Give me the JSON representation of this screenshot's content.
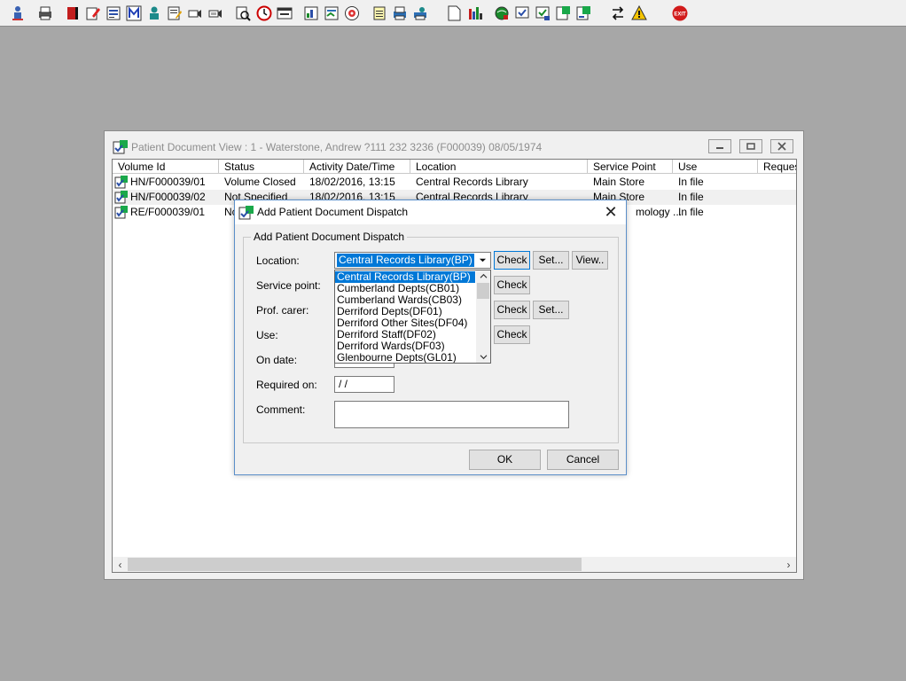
{
  "toolbar": {
    "icons": [
      "user-search-icon",
      "printer-icon",
      "book-red-icon",
      "edit-doc-icon",
      "list-form-icon",
      "mail-m-icon",
      "doctor-icon",
      "note-edit-icon",
      "projector-icon",
      "projector2-icon",
      "doc-search-icon",
      "clock-icon",
      "window-icon",
      "chart-doc-icon",
      "form-doc-icon",
      "cd-icon",
      "notepad-icon",
      "printer2-icon",
      "printer-user-icon",
      "blank-page-icon",
      "bar-chart-icon",
      "globe-tool-icon",
      "check-doc-icon",
      "check-doc2-icon",
      "doc-green-icon",
      "doc-green2-icon",
      "swap-arrows-icon",
      "warning-icon",
      "exit-icon"
    ],
    "exit_label": "EXIT"
  },
  "background_window": {
    "title": "Patient Document View : 1 - Waterstone, Andrew ?111 232 3236 (F000039) 08/05/1974",
    "columns": [
      "Volume Id",
      "Status",
      "Activity Date/Time",
      "Location",
      "Service Point",
      "Use",
      "Reques"
    ],
    "rows": [
      {
        "volume_id": "HN/F000039/01",
        "status": "Volume Closed",
        "activity": "18/02/2016, 13:15",
        "location": "Central Records Library",
        "service_point": "Main Store",
        "use": "In file"
      },
      {
        "volume_id": "HN/F000039/02",
        "status": "Not Specified",
        "activity": "18/02/2016, 13:15",
        "location": "Central Records Library",
        "service_point": "Main Store",
        "use": "In file"
      },
      {
        "volume_id": "RE/F000039/01",
        "status": "Nc",
        "activity": "",
        "location": "",
        "service_point": "mology ...",
        "use": "In file"
      }
    ]
  },
  "dialog": {
    "title": "Add Patient Document Dispatch",
    "group_title": "Add Patient Document Dispatch",
    "labels": {
      "location": "Location:",
      "service_point": "Service point:",
      "prof_carer": "Prof. carer:",
      "use": "Use:",
      "on_date": "On date:",
      "required_on": "Required on:",
      "comment": "Comment:"
    },
    "location_value": "Central Records Library(BP)",
    "required_on_value": " /  /",
    "dropdown_options": [
      "Central Records Library(BP)",
      "Cumberland Depts(CB01)",
      "Cumberland Wards(CB03)",
      "Derriford Depts(DF01)",
      "Derriford Other Sites(DF04)",
      "Derriford Staff(DF02)",
      "Derriford Wards(DF03)",
      "Glenbourne Depts(GL01)"
    ],
    "buttons": {
      "check": "Check",
      "set": "Set...",
      "view": "View..",
      "ok": "OK",
      "cancel": "Cancel"
    }
  },
  "colors": {
    "selection": "#0078d7",
    "desktop": "#a7a7a7"
  }
}
